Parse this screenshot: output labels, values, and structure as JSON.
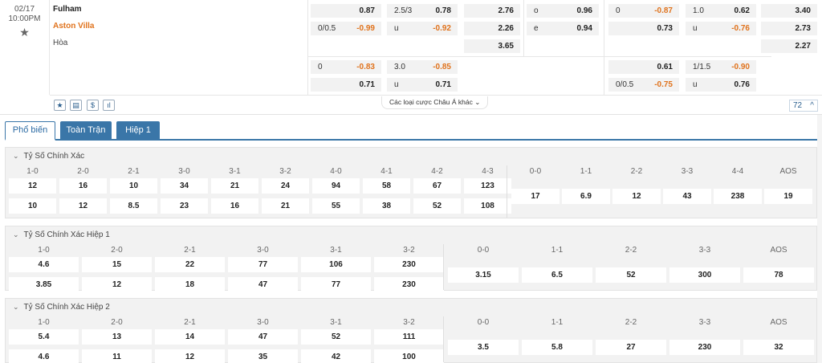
{
  "match": {
    "date": "02/17",
    "time": "10:00PM",
    "home": "Fulham",
    "away": "Aston Villa",
    "draw": "Hòa"
  },
  "odds_row1": [
    {
      "label": "",
      "value": "0.87",
      "neg": false
    },
    {
      "label": "2.5/3",
      "value": "0.78",
      "neg": false
    },
    {
      "label": "",
      "value": "2.76",
      "neg": false
    },
    {
      "label": "o",
      "value": "0.96",
      "neg": false
    },
    {
      "label": "0",
      "value": "-0.87",
      "neg": true
    },
    {
      "label": "1.0",
      "value": "0.62",
      "neg": false
    },
    {
      "label": "",
      "value": "3.40",
      "neg": false
    }
  ],
  "odds_row2": [
    {
      "label": "0/0.5",
      "value": "-0.99",
      "neg": true
    },
    {
      "label": "u",
      "value": "-0.92",
      "neg": true
    },
    {
      "label": "",
      "value": "2.26",
      "neg": false
    },
    {
      "label": "e",
      "value": "0.94",
      "neg": false
    },
    {
      "label": "",
      "value": "0.73",
      "neg": false
    },
    {
      "label": "u",
      "value": "-0.76",
      "neg": true
    },
    {
      "label": "",
      "value": "2.73",
      "neg": false
    }
  ],
  "odds_row3": [
    {
      "label": "",
      "value": "3.65",
      "neg": false
    },
    {
      "label": "",
      "value": "2.27",
      "neg": false
    }
  ],
  "odds_row4": [
    {
      "label": "0",
      "value": "-0.83",
      "neg": true
    },
    {
      "label": "3.0",
      "value": "-0.85",
      "neg": true
    },
    {
      "label": "",
      "value": "0.61",
      "neg": false
    },
    {
      "label": "1/1.5",
      "value": "-0.90",
      "neg": true
    }
  ],
  "odds_row5": [
    {
      "label": "",
      "value": "0.71",
      "neg": false
    },
    {
      "label": "u",
      "value": "0.71",
      "neg": false
    },
    {
      "label": "0/0.5",
      "value": "-0.75",
      "neg": true
    },
    {
      "label": "u",
      "value": "0.76",
      "neg": false
    }
  ],
  "icons": [
    "star-icon",
    "tv-icon",
    "dollar-icon",
    "stats-icon"
  ],
  "more_types": "Các loại cược Châu Á khác",
  "market_count": "72",
  "tabs": [
    "Phổ biến",
    "Toàn Trận",
    "Hiệp 1"
  ],
  "sections": [
    {
      "title": "Tỷ Số Chính Xác",
      "left_headers": [
        "1-0",
        "2-0",
        "2-1",
        "3-0",
        "3-1",
        "3-2",
        "4-0",
        "4-1",
        "4-2",
        "4-3"
      ],
      "left_row1": [
        "12",
        "16",
        "10",
        "34",
        "21",
        "24",
        "94",
        "58",
        "67",
        "123"
      ],
      "left_row2": [
        "10",
        "12",
        "8.5",
        "23",
        "16",
        "21",
        "55",
        "38",
        "52",
        "108"
      ],
      "right_headers": [
        "0-0",
        "1-1",
        "2-2",
        "3-3",
        "4-4",
        "AOS"
      ],
      "right_values": [
        "17",
        "6.9",
        "12",
        "43",
        "238",
        "19"
      ]
    },
    {
      "title": "Tỷ Số Chính Xác Hiệp 1",
      "left_headers": [
        "1-0",
        "2-0",
        "2-1",
        "3-0",
        "3-1",
        "3-2"
      ],
      "left_row1": [
        "4.6",
        "15",
        "22",
        "77",
        "106",
        "230"
      ],
      "left_row2": [
        "3.85",
        "12",
        "18",
        "47",
        "77",
        "230"
      ],
      "right_headers": [
        "0-0",
        "1-1",
        "2-2",
        "3-3",
        "AOS"
      ],
      "right_values": [
        "3.15",
        "6.5",
        "52",
        "300",
        "78"
      ]
    },
    {
      "title": "Tỷ Số Chính Xác Hiệp 2",
      "left_headers": [
        "1-0",
        "2-0",
        "2-1",
        "3-0",
        "3-1",
        "3-2"
      ],
      "left_row1": [
        "5.4",
        "13",
        "14",
        "47",
        "52",
        "111"
      ],
      "left_row2": [
        "4.6",
        "11",
        "12",
        "35",
        "42",
        "100"
      ],
      "right_headers": [
        "0-0",
        "1-1",
        "2-2",
        "3-3",
        "AOS"
      ],
      "right_values": [
        "3.5",
        "5.8",
        "27",
        "230",
        "32"
      ]
    }
  ],
  "colors": {
    "accent": "#3a76a8",
    "negative": "#e0731d",
    "cell_bg": "#f2f2f2"
  }
}
